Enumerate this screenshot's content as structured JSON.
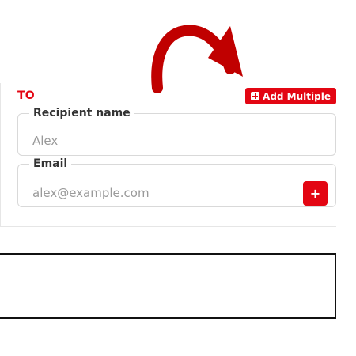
{
  "recipient_section": {
    "to_label": "TO",
    "add_multiple_label": "Add Multiple",
    "name_field": {
      "label": "Recipient name",
      "placeholder": "Alex"
    },
    "email_field": {
      "label": "Email",
      "placeholder": "alex@example.com",
      "add_button_label": "+"
    }
  },
  "colors": {
    "accent": "#e30613",
    "arrow": "#c00000"
  },
  "icons": {
    "arrow": "curved-arrow-icon",
    "add_multiple": "plus-square-icon"
  }
}
